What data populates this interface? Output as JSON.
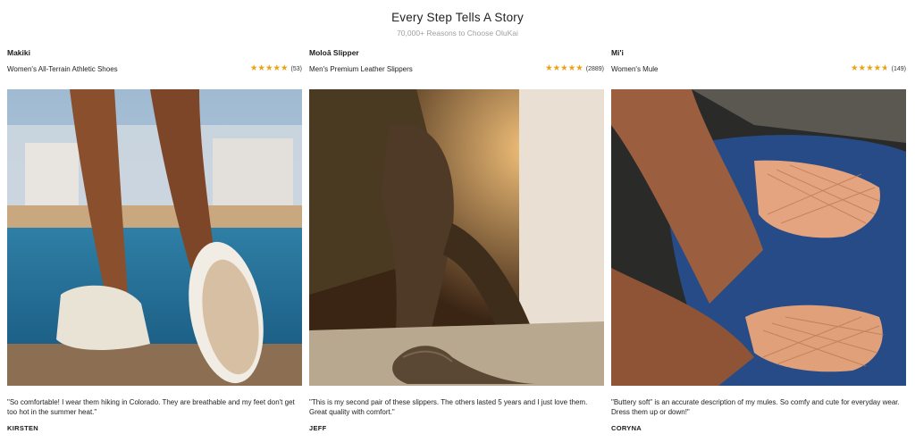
{
  "header": {
    "title": "Every Step Tells A Story",
    "subtitle": "70,000+ Reasons to Choose OluKai"
  },
  "cards": [
    {
      "name": "Makiki",
      "subtitle": "Women's All-Terrain Athletic Shoes",
      "rating": 5,
      "review_count": "(53)",
      "image": "woman-wearing-white-athletic-shoes-on-seawall",
      "quote": "\"So comfortable! I wear them hiking in Colorado. They are breathable and my feet don't get too hot in the summer heat.\"",
      "author": "KIRSTEN"
    },
    {
      "name": "Moloā Slipper",
      "subtitle": "Men's Premium Leather Slippers",
      "rating": 5,
      "review_count": "(2889)",
      "image": "man-in-brown-pants-wearing-leather-slippers",
      "quote": "\"This is my second pair of these slippers. The others lasted 5 years and I just love them. Great quality with comfort.\"",
      "author": "JEFF"
    },
    {
      "name": "Mi'i",
      "subtitle": "Women's Mule",
      "rating": 4.7,
      "review_count": "(149)",
      "image": "feet-in-woven-tan-leather-mules-on-blue-chair",
      "quote": "\"Buttery soft\" is an accurate description of my mules. So comfy and cute for everyday wear. Dress them up or down!\"",
      "author": "CORYNA"
    }
  ]
}
